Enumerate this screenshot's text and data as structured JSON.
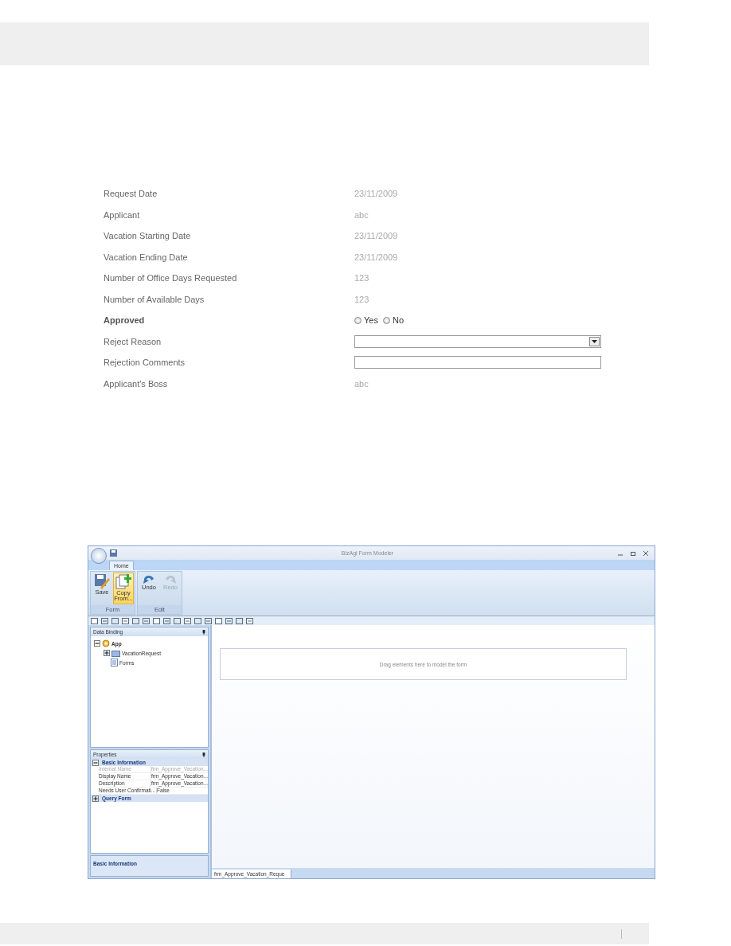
{
  "form": {
    "rows": [
      {
        "label": "Request Date",
        "kind": "text",
        "required": false,
        "value": "23/11/2009"
      },
      {
        "label": "Applicant",
        "kind": "text",
        "required": false,
        "value": "abc"
      },
      {
        "label": "Vacation Starting Date",
        "kind": "text",
        "required": false,
        "value": "23/11/2009"
      },
      {
        "label": "Vacation Ending Date",
        "kind": "text",
        "required": false,
        "value": "23/11/2009"
      },
      {
        "label": "Number of Office Days Requested",
        "kind": "text",
        "required": false,
        "value": "123"
      },
      {
        "label": "Number of Available Days",
        "kind": "text",
        "required": false,
        "value": "123"
      },
      {
        "label": "Approved",
        "kind": "radio",
        "required": true,
        "options": [
          {
            "label": "Yes",
            "selected": false
          },
          {
            "label": "No",
            "selected": false
          }
        ]
      },
      {
        "label": "Reject Reason",
        "kind": "select",
        "required": false
      },
      {
        "label": "Rejection Comments",
        "kind": "input",
        "required": false
      },
      {
        "label": "Applicant's Boss",
        "kind": "text",
        "required": false,
        "value": "abc"
      }
    ]
  },
  "window": {
    "title": "BizAgi Form Modeler",
    "tabs": [
      {
        "label": "Home",
        "selected": true
      }
    ],
    "ribbon_groups": [
      {
        "label": "Form",
        "buttons": [
          {
            "label": "Save",
            "kind": "save",
            "highlighted": false,
            "disabled": false
          },
          {
            "label": "Copy From...",
            "kind": "copy",
            "highlighted": true,
            "disabled": false
          }
        ]
      },
      {
        "label": "Edit",
        "buttons": [
          {
            "label": "Undo",
            "kind": "undo",
            "highlighted": false,
            "disabled": false
          },
          {
            "label": "Redo",
            "kind": "redo",
            "highlighted": false,
            "disabled": true
          }
        ]
      }
    ],
    "data_binding": {
      "title": "Data Binding",
      "tree": [
        {
          "label": "App",
          "kind": "app",
          "expanded": true,
          "children": [
            {
              "label": "VacationRequest",
              "kind": "entity",
              "expanded": false
            },
            {
              "label": "Forms",
              "kind": "forms"
            }
          ]
        }
      ]
    },
    "properties": {
      "title": "Properties",
      "categories": [
        {
          "label": "Basic Information",
          "expanded": true,
          "rows": [
            {
              "name": "Internal Name",
              "value": "frm_Approve_Vacation...",
              "disabled": true
            },
            {
              "name": "Display Name",
              "value": "frm_Approve_Vacation...",
              "disabled": false
            },
            {
              "name": "Description",
              "value": "frm_Approve_Vacation...",
              "disabled": false
            },
            {
              "name": "Needs User Confirmati...",
              "value": "False",
              "disabled": false
            }
          ]
        },
        {
          "label": "Query Form",
          "expanded": false
        }
      ],
      "description": "Basic Information"
    },
    "canvas": {
      "hint": "Drag elements here to model the form"
    },
    "document_tabs": [
      {
        "label": "frm_Approve_Vacation_Reque",
        "selected": true
      }
    ]
  }
}
